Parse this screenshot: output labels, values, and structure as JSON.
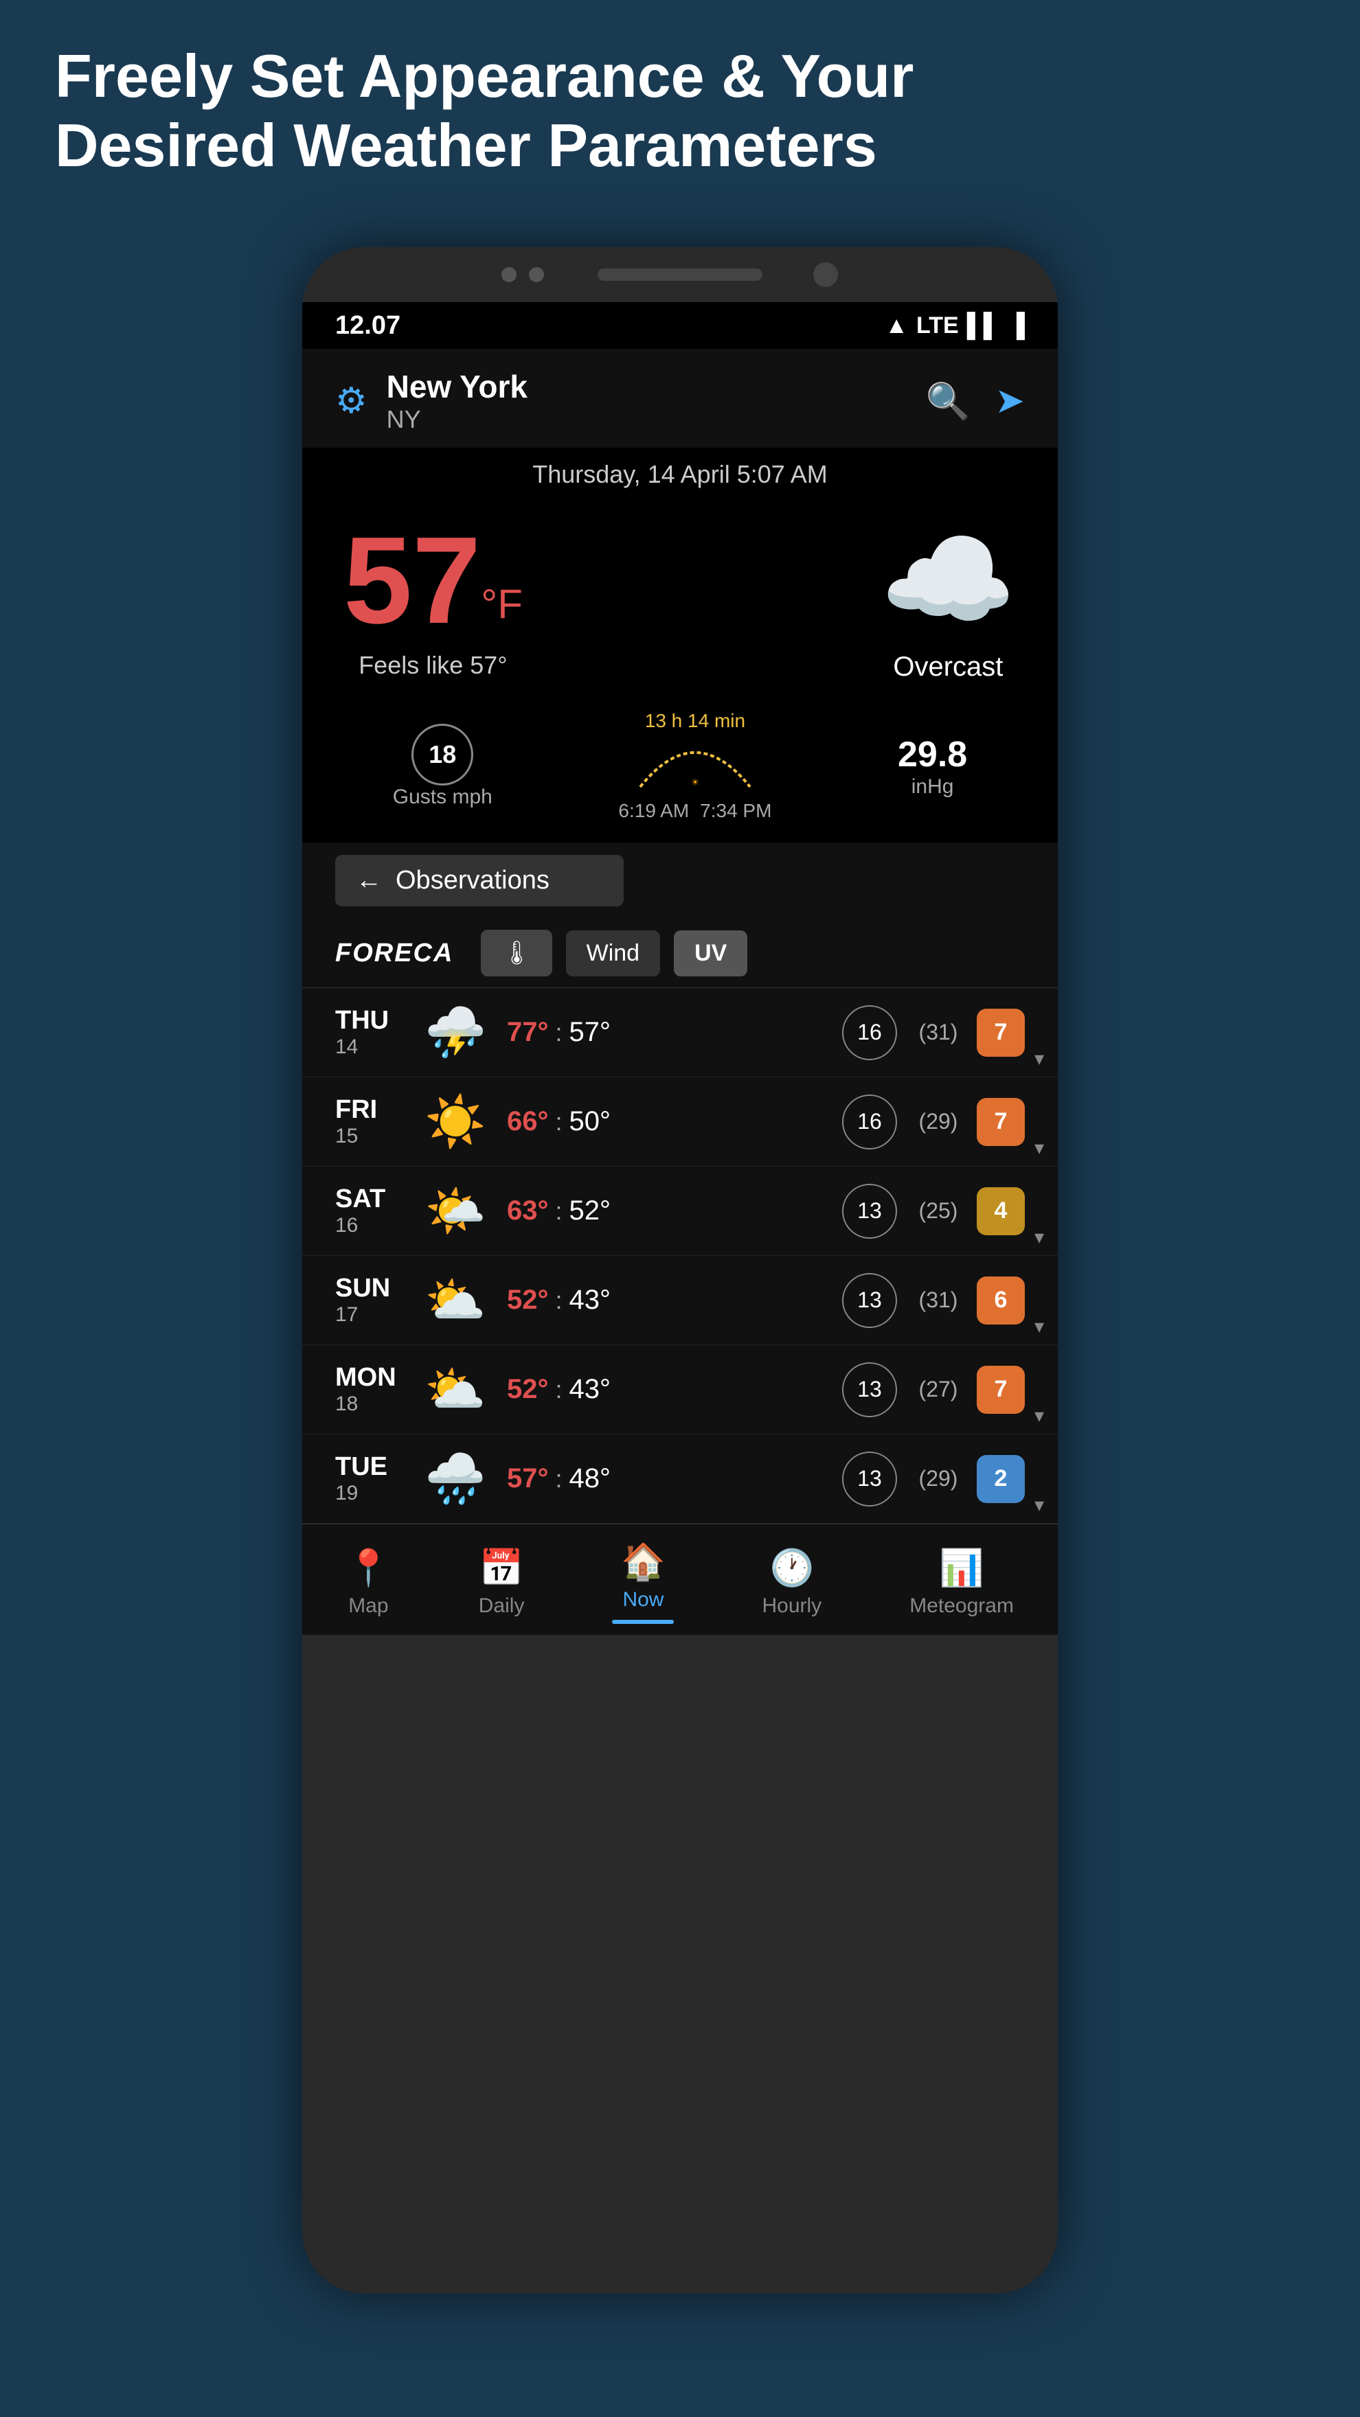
{
  "page": {
    "title_line1": "Freely Set Appearance & Your",
    "title_line2": "Desired Weather Parameters"
  },
  "status_bar": {
    "time": "12.07",
    "signal": "▲ LTE",
    "battery": "🔋"
  },
  "header": {
    "city": "New York",
    "state": "NY",
    "date": "Thursday, 14 April 5:07 AM"
  },
  "weather": {
    "temperature": "57",
    "unit": "°F",
    "feels_like": "Feels like 57°",
    "condition": "Overcast",
    "gusts": "18",
    "gusts_label": "Gusts mph",
    "duration": "13 h 14 min",
    "sunrise": "6:19 AM",
    "sunset": "7:34 PM",
    "pressure": "29.8",
    "pressure_unit": "inHg"
  },
  "observations_button": {
    "label": "Observations"
  },
  "filter_tabs": {
    "provider": "FORECA",
    "temp": "🌡",
    "wind": "Wind",
    "uv": "UV"
  },
  "forecast": [
    {
      "day": "THU",
      "date": "14",
      "icon": "⛈️",
      "hi": "77°",
      "lo": "57°",
      "wind": "16",
      "gust": "(31)",
      "uv": "7",
      "uv_color": "uv-orange"
    },
    {
      "day": "FRI",
      "date": "15",
      "icon": "☀️",
      "hi": "66°",
      "lo": "50°",
      "wind": "16",
      "gust": "(29)",
      "uv": "7",
      "uv_color": "uv-orange"
    },
    {
      "day": "SAT",
      "date": "16",
      "icon": "🌤️",
      "hi": "63°",
      "lo": "52°",
      "wind": "13",
      "gust": "(25)",
      "uv": "4",
      "uv_color": "uv-yellow"
    },
    {
      "day": "SUN",
      "date": "17",
      "icon": "⛅",
      "hi": "52°",
      "lo": "43°",
      "wind": "13",
      "gust": "(31)",
      "uv": "6",
      "uv_color": "uv-orange"
    },
    {
      "day": "MON",
      "date": "18",
      "icon": "⛅",
      "hi": "52°",
      "lo": "43°",
      "wind": "13",
      "gust": "(27)",
      "uv": "7",
      "uv_color": "uv-orange"
    },
    {
      "day": "TUE",
      "date": "19",
      "icon": "🌧️",
      "hi": "57°",
      "lo": "48°",
      "wind": "13",
      "gust": "(29)",
      "uv": "2",
      "uv_color": "uv-blue"
    }
  ],
  "bottom_nav": [
    {
      "label": "Map",
      "icon": "📍",
      "active": false
    },
    {
      "label": "Daily",
      "icon": "📅",
      "active": false
    },
    {
      "label": "Now",
      "icon": "🏠",
      "active": true
    },
    {
      "label": "Hourly",
      "icon": "🕐",
      "active": false
    },
    {
      "label": "Meteogram",
      "icon": "📊",
      "active": false
    }
  ]
}
